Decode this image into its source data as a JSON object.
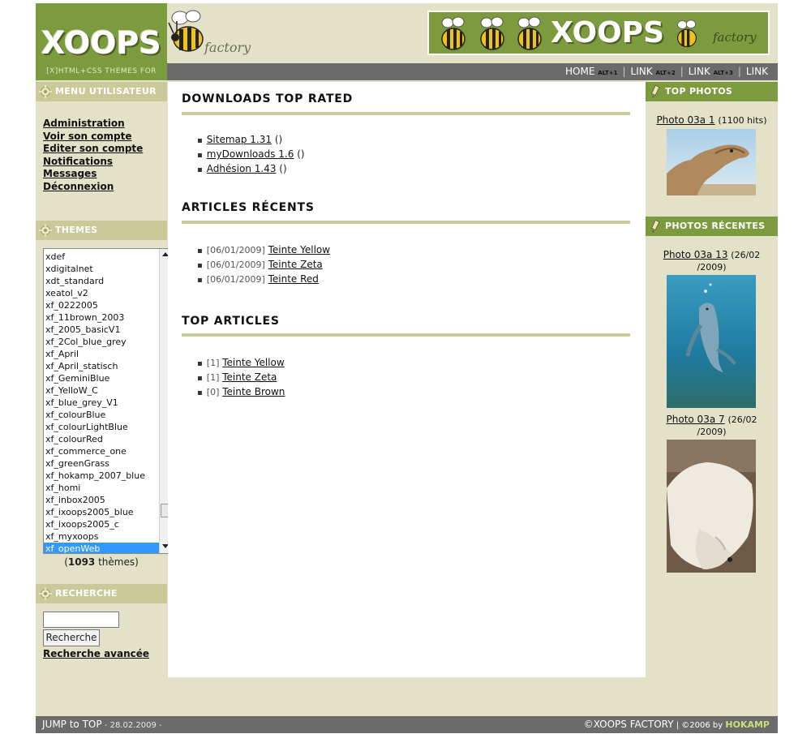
{
  "header": {
    "logo_text": "XOOPS",
    "logo_sub": "factory",
    "tagline": "[X]HTML+CSS THEMES FOR XOOPS",
    "banner_text": "XOOPS",
    "banner_sub": "factory"
  },
  "nav": {
    "items": [
      {
        "label": "HOME",
        "key": "ALT+1"
      },
      {
        "label": "LINK",
        "key": "ALT+2"
      },
      {
        "label": "LINK",
        "key": "ALT+3"
      },
      {
        "label": "LINK",
        "key": ""
      }
    ]
  },
  "usermenu": {
    "title": "MENU UTILISATEUR",
    "links": [
      "Administration",
      "Voir son compte",
      "Editer son compte",
      "Notifications",
      "Messages",
      "Déconnexion"
    ]
  },
  "themes": {
    "title": "THEMES",
    "options": [
      "xdef",
      "xdigitalnet",
      "xdt_standard",
      "xeatol_v2",
      "xf_0222005",
      "xf_11brown_2003",
      "xf_2005_basicV1",
      "xf_2Col_blue_grey",
      "xf_April",
      "xf_April_statisch",
      "xf_GeminiBlue",
      "xf_YelloW_C",
      "xf_blue_grey_V1",
      "xf_colourBlue",
      "xf_colourLightBlue",
      "xf_colourRed",
      "xf_commerce_one",
      "xf_greenGrass",
      "xf_hokamp_2007_blue",
      "xf_homi",
      "xf_inbox2005",
      "xf_ixoops2005_blue",
      "xf_ixoops2005_c",
      "xf_myxoops",
      "xf_openWeb"
    ],
    "selected": "xf_openWeb",
    "count": "1093",
    "count_suffix": " thèmes"
  },
  "search": {
    "title": "RECHERCHE",
    "input_value": "",
    "button_label": "Recherche",
    "advanced_label": "Recherche avancée"
  },
  "main": {
    "downloads": {
      "title": "DOWNLOADS TOP RATED",
      "items": [
        {
          "label": "Sitemap 1.31",
          "suffix": " ()"
        },
        {
          "label": "myDownloads 1.6",
          "suffix": " ()"
        },
        {
          "label": "Adhésion 1.43",
          "suffix": " ()"
        }
      ]
    },
    "recent_articles": {
      "title": "ARTICLES RÉCENTS",
      "items": [
        {
          "meta": "[06/01/2009]",
          "label": "Teinte Yellow"
        },
        {
          "meta": "[06/01/2009]",
          "label": "Teinte Zeta"
        },
        {
          "meta": "[06/01/2009]",
          "label": "Teinte Red"
        }
      ]
    },
    "top_articles": {
      "title": "TOP ARTICLES",
      "items": [
        {
          "meta": "[1]",
          "label": "Teinte Yellow"
        },
        {
          "meta": "[1]",
          "label": "Teinte Zeta"
        },
        {
          "meta": "[0]",
          "label": "Teinte Brown"
        }
      ]
    }
  },
  "right": {
    "top_photos": {
      "title": "TOP PHOTOS",
      "items": [
        {
          "label": "Photo 03a 1",
          "meta": "(1100 hits)"
        }
      ]
    },
    "recent_photos": {
      "title": "PHOTOS RÉCENTES",
      "items": [
        {
          "label": "Photo 03a 13",
          "meta": "(26/02",
          "meta2": "/2009)"
        },
        {
          "label": "Photo 03a 7",
          "meta": "(26/02",
          "meta2": "/2009)"
        }
      ]
    }
  },
  "footer": {
    "jump": "JUMP to TOP",
    "date": " - 28.02.2009 -",
    "copyright": "©XOOPS FACTORY",
    "year": " | ©2006 by ",
    "author": "HOKAMP"
  },
  "colors": {
    "olive_green": "#7c9b3e",
    "khaki": "#c9c99a",
    "background": "#e3e2c8",
    "bar_grey": "#6b6b6b"
  }
}
